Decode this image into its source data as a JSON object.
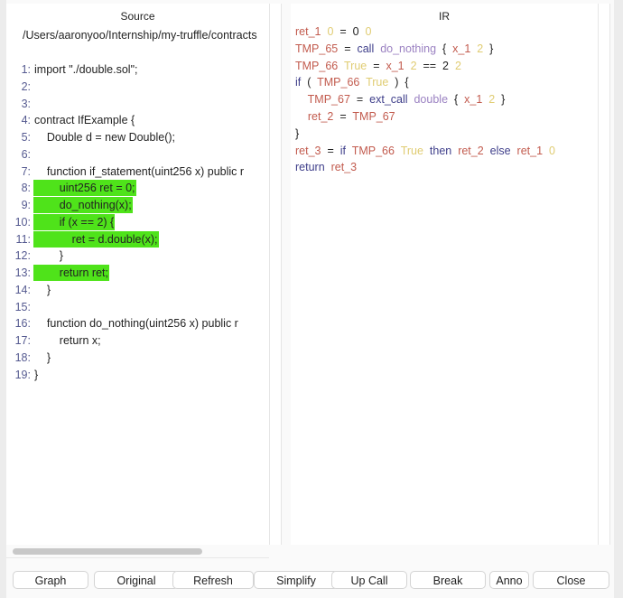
{
  "colors": {
    "var": "#c25b4e",
    "val": "#e0cc72",
    "fn": "#9b82c2",
    "kw": "#3e3e8a",
    "op": "#222222",
    "highlight": "#4fe31a"
  },
  "source": {
    "title": "Source",
    "path": "/Users/aaronyoo/Internship/my-truffle/contracts",
    "lines": [
      {
        "n": "1:",
        "code": "import \"./double.sol\";",
        "hl": false,
        "indent": 0
      },
      {
        "n": "2:",
        "code": "",
        "hl": false,
        "indent": 0
      },
      {
        "n": "3:",
        "code": "",
        "hl": false,
        "indent": 0
      },
      {
        "n": "4:",
        "code": "contract IfExample {",
        "hl": false,
        "indent": 0
      },
      {
        "n": "5:",
        "code": "    Double d = new Double();",
        "hl": false,
        "indent": 0
      },
      {
        "n": "6:",
        "code": "",
        "hl": false,
        "indent": 0
      },
      {
        "n": "7:",
        "code": "    function if_statement(uint256 x) public r",
        "hl": false,
        "indent": 0
      },
      {
        "n": "8:",
        "code": "        uint256 ret = 0;",
        "hl": true,
        "indent": 0
      },
      {
        "n": "9:",
        "code": "        do_nothing(x);",
        "hl": true,
        "indent": 0
      },
      {
        "n": "10:",
        "code": "        if (x == 2) {",
        "hl": true,
        "indent": 0
      },
      {
        "n": "11:",
        "code": "            ret = d.double(x);",
        "hl": true,
        "indent": 0
      },
      {
        "n": "12:",
        "code": "        }",
        "hl": false,
        "indent": 0
      },
      {
        "n": "13:",
        "code": "        return ret;",
        "hl": true,
        "indent": 0
      },
      {
        "n": "14:",
        "code": "    }",
        "hl": false,
        "indent": 0
      },
      {
        "n": "15:",
        "code": "",
        "hl": false,
        "indent": 0
      },
      {
        "n": "16:",
        "code": "    function do_nothing(uint256 x) public r",
        "hl": false,
        "indent": 0
      },
      {
        "n": "17:",
        "code": "        return x;",
        "hl": false,
        "indent": 0
      },
      {
        "n": "18:",
        "code": "    }",
        "hl": false,
        "indent": 0
      },
      {
        "n": "19:",
        "code": "}",
        "hl": false,
        "indent": 0
      }
    ]
  },
  "ir": {
    "title": "IR",
    "lines": [
      [
        [
          "ret_1",
          "var"
        ],
        [
          "0",
          "val"
        ],
        [
          "=",
          "op"
        ],
        [
          "0",
          "op"
        ],
        [
          "0",
          "val"
        ]
      ],
      [
        [
          "TMP_65",
          "var"
        ],
        [
          "=",
          "op"
        ],
        [
          "call",
          "kw"
        ],
        [
          "do_nothing",
          "fn"
        ],
        [
          "{",
          "op"
        ],
        [
          "x_1",
          "var"
        ],
        [
          "2",
          "val"
        ],
        [
          "}",
          "op"
        ]
      ],
      [
        [
          "TMP_66",
          "var"
        ],
        [
          "True",
          "val"
        ],
        [
          "=",
          "op"
        ],
        [
          "x_1",
          "var"
        ],
        [
          "2",
          "val"
        ],
        [
          "==",
          "op"
        ],
        [
          "2",
          "op"
        ],
        [
          "2",
          "val"
        ]
      ],
      [
        [
          "if",
          "kw"
        ],
        [
          "(",
          "op"
        ],
        [
          "TMP_66",
          "var"
        ],
        [
          "True",
          "val"
        ],
        [
          ")",
          "op"
        ],
        [
          "{",
          "op"
        ]
      ],
      [
        [
          "    TMP_67",
          "var"
        ],
        [
          "=",
          "op"
        ],
        [
          "ext_call",
          "kw"
        ],
        [
          "double",
          "fn"
        ],
        [
          "{",
          "op"
        ],
        [
          "x_1",
          "var"
        ],
        [
          "2",
          "val"
        ],
        [
          "}",
          "op"
        ]
      ],
      [
        [
          "    ret_2",
          "var"
        ],
        [
          "=",
          "op"
        ],
        [
          "TMP_67",
          "var"
        ]
      ],
      [
        [
          "}",
          "op"
        ]
      ],
      [
        [
          "ret_3",
          "var"
        ],
        [
          "=",
          "op"
        ],
        [
          "if",
          "kw"
        ],
        [
          "TMP_66",
          "var"
        ],
        [
          "True",
          "val"
        ],
        [
          "then",
          "kw"
        ],
        [
          "ret_2",
          "var"
        ],
        [
          "else",
          "kw"
        ],
        [
          "ret_1",
          "var"
        ],
        [
          "0",
          "val"
        ]
      ],
      [
        [
          "return",
          "kw"
        ],
        [
          "ret_3",
          "var"
        ]
      ]
    ]
  },
  "buttons": [
    "Graph",
    "Original",
    "Refresh",
    "Simplify",
    "Up Call",
    "Break",
    "Anno",
    "Close"
  ]
}
